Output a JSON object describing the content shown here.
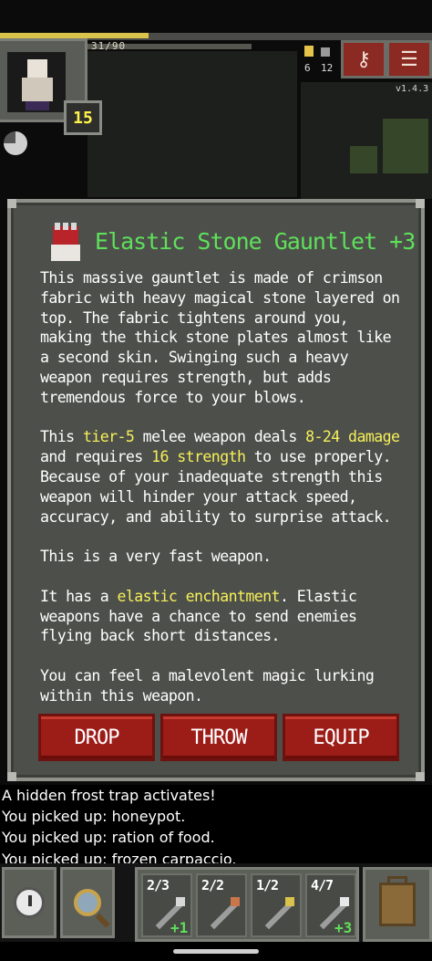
{
  "hud": {
    "hp_text": "31/90",
    "hp_fraction": 0.344,
    "level": "15",
    "gold_count": "6",
    "depth_count": "12",
    "version": "v1.4.3",
    "journal_icon": "key-icon",
    "menu_icon": "menu-icon"
  },
  "item": {
    "icon": "gauntlet-icon",
    "title": "Elastic Stone Gauntlet +3",
    "p1": "This massive gauntlet is made of crimson fabric with heavy magical stone layered on top. The fabric tightens around you, making the thick stone plates almost like a second skin. Swinging such a heavy weapon requires strength, but adds tremendous force to your blows.",
    "p2": {
      "a": "This ",
      "tier": "tier-5",
      "b": " melee weapon deals ",
      "damage": "8-24 damage",
      "c": " and requires ",
      "strength": "16 strength",
      "d": " to use properly. Because of your inadequate strength this weapon will hinder your attack speed, accuracy, and ability to surprise attack."
    },
    "p3": "This is a very fast weapon.",
    "p4": {
      "a": "It has a ",
      "ench": "elastic enchantment",
      "b": ". Elastic weapons have a chance to send enemies flying back short distances."
    },
    "p5": "You can feel a malevolent magic lurking within this weapon.",
    "buttons": [
      "DROP",
      "THROW",
      "EQUIP"
    ]
  },
  "log": [
    "A hidden frost trap activates!",
    "You picked up: honeypot.",
    "You picked up: ration of food.",
    "You picked up: frozen carpaccio."
  ],
  "toolbar": {
    "wait_icon": "clock-icon",
    "search_icon": "magnifier-icon",
    "backpack_icon": "backpack-icon",
    "quickslots": [
      {
        "charges": "2/3",
        "bonus": "+1",
        "tip_color": "#d8d8d8"
      },
      {
        "charges": "2/2",
        "bonus": "",
        "tip_color": "#c8764a"
      },
      {
        "charges": "1/2",
        "bonus": "",
        "tip_color": "#d9c34a"
      },
      {
        "charges": "4/7",
        "bonus": "+3",
        "tip_color": "#e8e8e8"
      }
    ]
  }
}
